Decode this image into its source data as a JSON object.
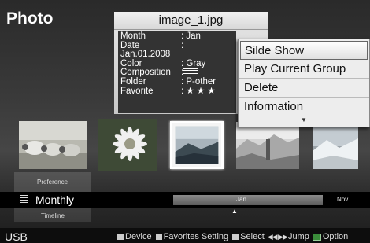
{
  "app": {
    "title": "Photo"
  },
  "info_panel": {
    "filename": "image_1.jpg",
    "rows": [
      {
        "label": "Month",
        "value": ": Jan"
      },
      {
        "label": "Date",
        "value": ":"
      },
      {
        "label": "Jan.01.2008",
        "value": ""
      },
      {
        "label": "Color",
        "value": ": Gray"
      },
      {
        "label": "Composition",
        "value": ":"
      },
      {
        "label": "Folder",
        "value": ": P-other"
      },
      {
        "label": "Favorite",
        "value": ": ★ ★ ★"
      }
    ]
  },
  "menu": {
    "items": [
      "Silde Show",
      "Play Current Group",
      "Delete",
      "Information"
    ],
    "selected_index": 0,
    "more_arrow": "▼"
  },
  "thumbnails": [
    {
      "name": "sheep"
    },
    {
      "name": "flower"
    },
    {
      "name": "landscape",
      "selected": true
    },
    {
      "name": "cactus"
    },
    {
      "name": "snow"
    }
  ],
  "timeline": {
    "preference_label": "Preference",
    "mode": "Monthly",
    "timeline_label": "Timeline",
    "current_month": "Jan",
    "next_month": "Nov",
    "marker": "▲"
  },
  "footer": {
    "source": "USB",
    "hints": {
      "device": "Device",
      "favorites": "Favorites Setting",
      "select": "Select",
      "jump_arrows": "◀◀ ▶▶",
      "jump": "Jump",
      "option": "Option"
    }
  },
  "colors": {
    "background": "#333333",
    "menu_bg": "#ededed",
    "footer_bg": "#0d0d0d"
  }
}
